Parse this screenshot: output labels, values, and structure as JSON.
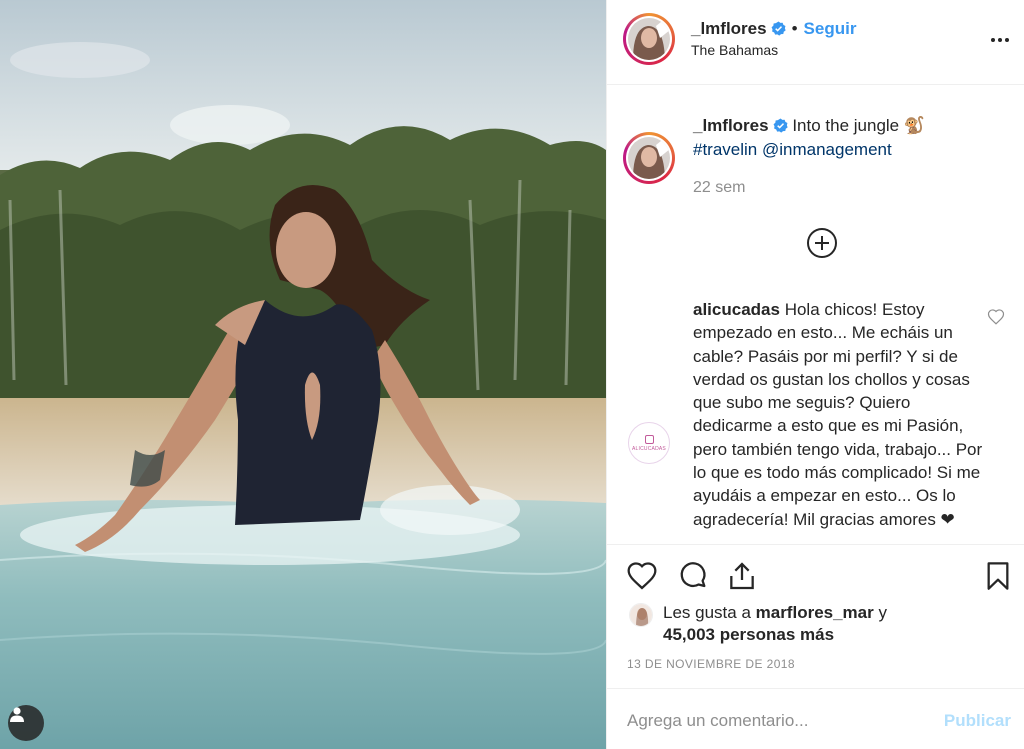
{
  "post": {
    "username": "_lmflores",
    "verified": true,
    "follow_label": "Seguir",
    "separator": "•",
    "location": "The Bahamas",
    "caption": {
      "username": "_lmflores",
      "text": "Into the jungle 🐒",
      "tags": "#travelin @inmanagement",
      "time": "22 sem"
    }
  },
  "comment": {
    "username": "alicucadas",
    "text": "Hola chicos! Estoy empezado en esto... Me echáis un cable? Pasáis por mi perfil? Y si de verdad os gustan los chollos y cosas que subo me seguis? Quiero dedicarme a esto que es mi Pasión, pero también tengo vida, trabajo... Por lo que es todo más complicado! Si me ayudáis a empezar en esto... Os lo agradecería! Mil gracias amores ❤",
    "avatar_text": "ALICUCADAS"
  },
  "likes": {
    "prefix": "Les gusta a ",
    "user": "marflores_mar",
    "mid": " y",
    "count": "45,003 personas más"
  },
  "date": "13 DE NOVIEMBRE DE 2018",
  "add_comment": {
    "placeholder": "Agrega un comentario...",
    "publish_label": "Publicar"
  },
  "icons": [
    "user-tag-icon",
    "verified-icon",
    "more-options-icon",
    "load-more-comments-icon",
    "heart-icon",
    "comment-icon",
    "share-icon",
    "bookmark-icon"
  ],
  "colors": {
    "accent": "#3897f0",
    "hashtag": "#003569",
    "muted": "#8e8e8e",
    "publish_disabled": "#b2dffc"
  }
}
